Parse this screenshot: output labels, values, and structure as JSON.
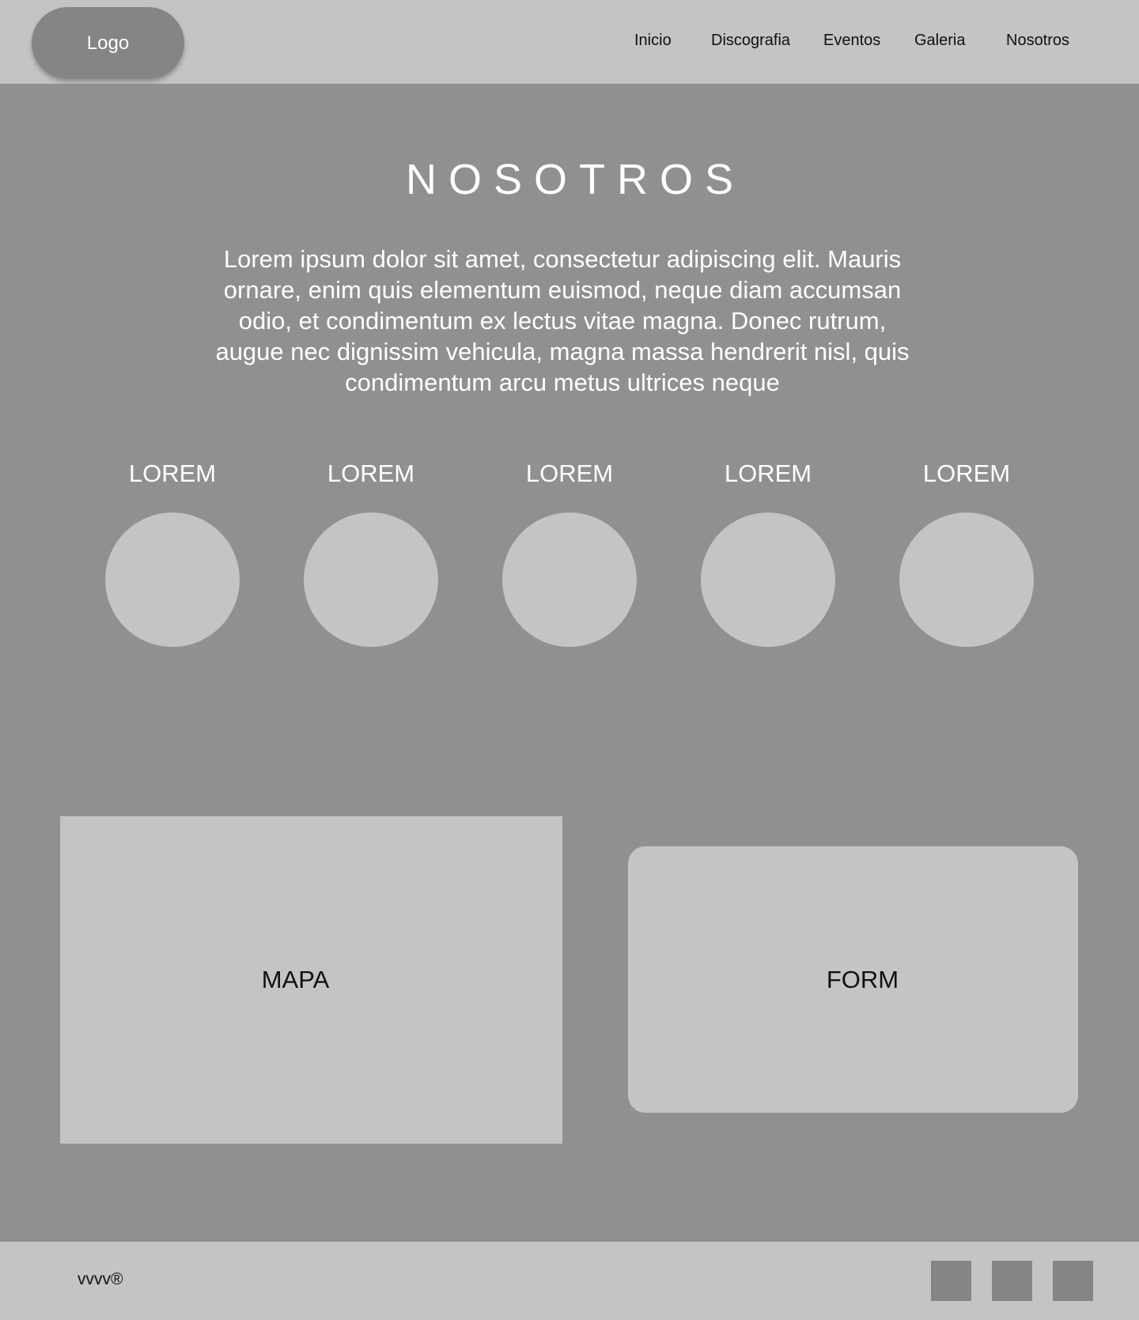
{
  "header": {
    "logo": "Logo",
    "nav": [
      "Inicio",
      "Discografia",
      "Eventos",
      "Galeria",
      "Nosotros"
    ]
  },
  "main": {
    "title": "NOSOTROS",
    "intro": "Lorem ipsum dolor sit amet, consectetur adipiscing elit. Mauris ornare, enim quis elementum euismod, neque diam accumsan odio, et condimentum ex lectus vitae magna. Donec rutrum, augue nec dignissim vehicula, magna massa hendrerit nisl, quis condimentum arcu metus ultrices neque",
    "members": [
      {
        "label": "LOREM"
      },
      {
        "label": "LOREM"
      },
      {
        "label": "LOREM"
      },
      {
        "label": "LOREM"
      },
      {
        "label": "LOREM"
      }
    ],
    "map_label": "MAPA",
    "form_label": "FORM"
  },
  "footer": {
    "brand": "vvvv®",
    "social_icons": [
      "social-icon-1",
      "social-icon-2",
      "social-icon-3"
    ]
  },
  "colors": {
    "background": "#918f90",
    "bars": "#c4c4c4",
    "dark_block": "#858585",
    "text_light": "#ffffff",
    "text_dark": "#111111"
  }
}
